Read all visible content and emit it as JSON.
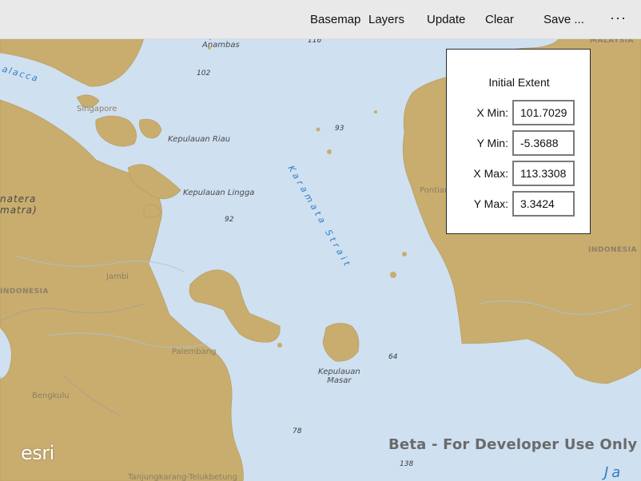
{
  "toolbar": {
    "buttons": [
      {
        "label": "Basemap"
      },
      {
        "label": "Layers"
      },
      {
        "label": "Update"
      },
      {
        "label": "Clear"
      },
      {
        "label": "Save ..."
      }
    ],
    "more_label": "···"
  },
  "panel": {
    "title": "Initial Extent",
    "fields": [
      {
        "label": "X Min:",
        "value": "101.7029"
      },
      {
        "label": "Y Min:",
        "value": "-5.3688"
      },
      {
        "label": "X Max:",
        "value": "113.3308"
      },
      {
        "label": "Y Max:",
        "value": "3.3424"
      }
    ]
  },
  "map": {
    "labels": {
      "anambas": "Kepulauan\nAnambas",
      "malacca": "alacca",
      "singapore": "Singapore",
      "riau": "Kepulauan Riau",
      "lingga": "Kepulauan Lingga",
      "sumatera": "natera\nmatra)",
      "indonesia_w": "INDONESIA",
      "indonesia_e": "INDONESIA",
      "malaysia": "MALAYSIA",
      "jambi": "Jambi",
      "palembang": "Palembang",
      "bengkulu": "Bengkulu",
      "pontianak": "Pontianak",
      "masar": "Kepulauan\nMasar",
      "strait": "Karamata Strait",
      "java": "Ja",
      "bottom_city": "Tanjungkarang-Telukbetung",
      "depth_116": "116",
      "depth_102": "102",
      "depth_93": "93",
      "depth_92": "92",
      "depth_64": "64",
      "depth_78": "78",
      "depth_138": "138"
    },
    "watermark": "Beta - For Developer Use Only",
    "logo": "esri",
    "colors": {
      "water": "#cfe0f1",
      "land": "#c8ad6e",
      "deep_water": "#a9c6e6"
    }
  }
}
